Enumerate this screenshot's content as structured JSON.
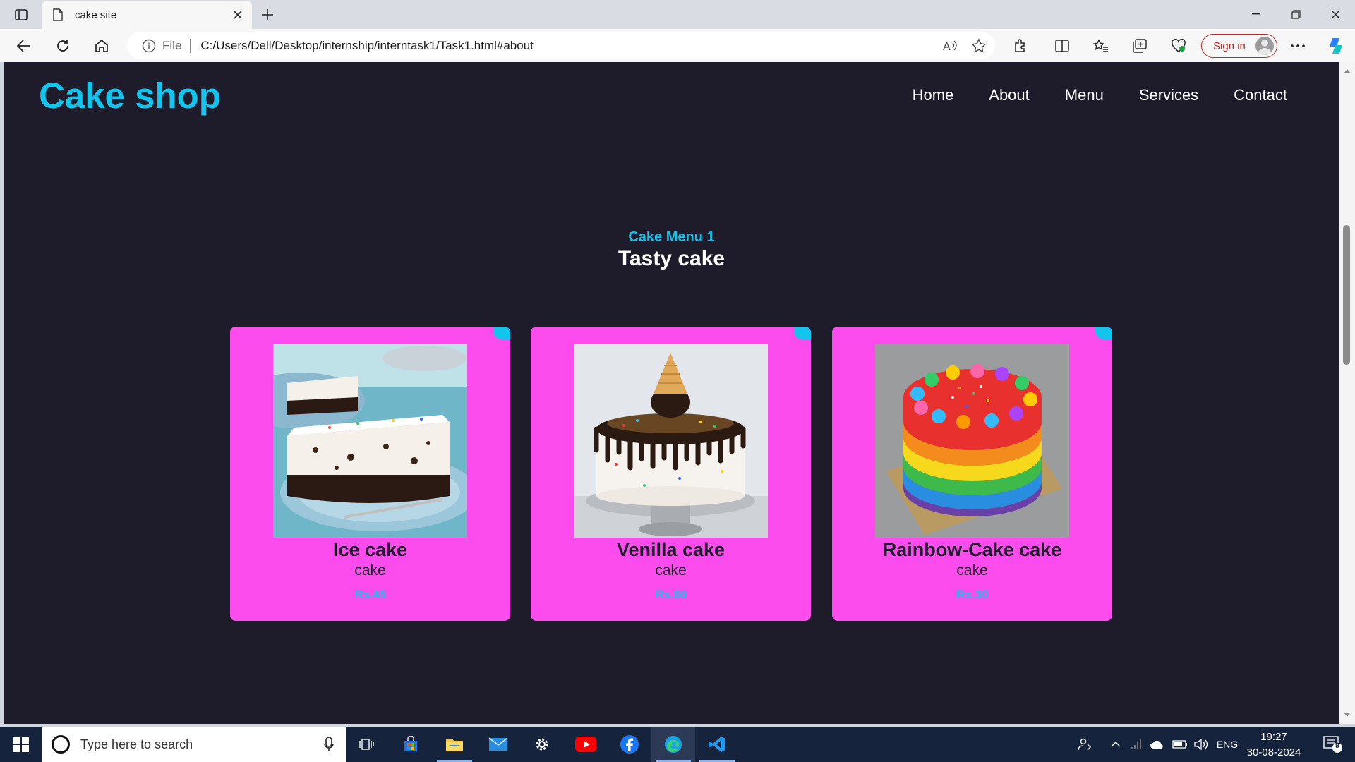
{
  "browser": {
    "tab_title": "cake site",
    "address_prefix": "File",
    "url": "C:/Users/Dell/Desktop/internship/interntask1/Task1.html#about",
    "signin_label": "Sign in"
  },
  "site": {
    "logo": "Cake shop",
    "nav": [
      "Home",
      "About",
      "Menu",
      "Services",
      "Contact"
    ],
    "section_subtitle": "Cake Menu 1",
    "section_title": "Tasty cake",
    "cards": [
      {
        "name": "Ice cake",
        "type": "cake",
        "price": "Rs.45",
        "image": "ice-cake-slice"
      },
      {
        "name": "Venilla cake",
        "type": "cake",
        "price": "Rs.60",
        "image": "sprinkle-drip-cake-with-cone"
      },
      {
        "name": "Rainbow-Cake cake",
        "type": "cake",
        "price": "Rs.30",
        "image": "rainbow-layer-cake"
      }
    ],
    "colors": {
      "background": "#1e1b2a",
      "accent": "#13c4ec",
      "card": "#fc4ced"
    }
  },
  "taskbar": {
    "search_placeholder": "Type here to search",
    "language": "ENG",
    "time": "19:27",
    "date": "30-08-2024",
    "notification_count": "9"
  }
}
